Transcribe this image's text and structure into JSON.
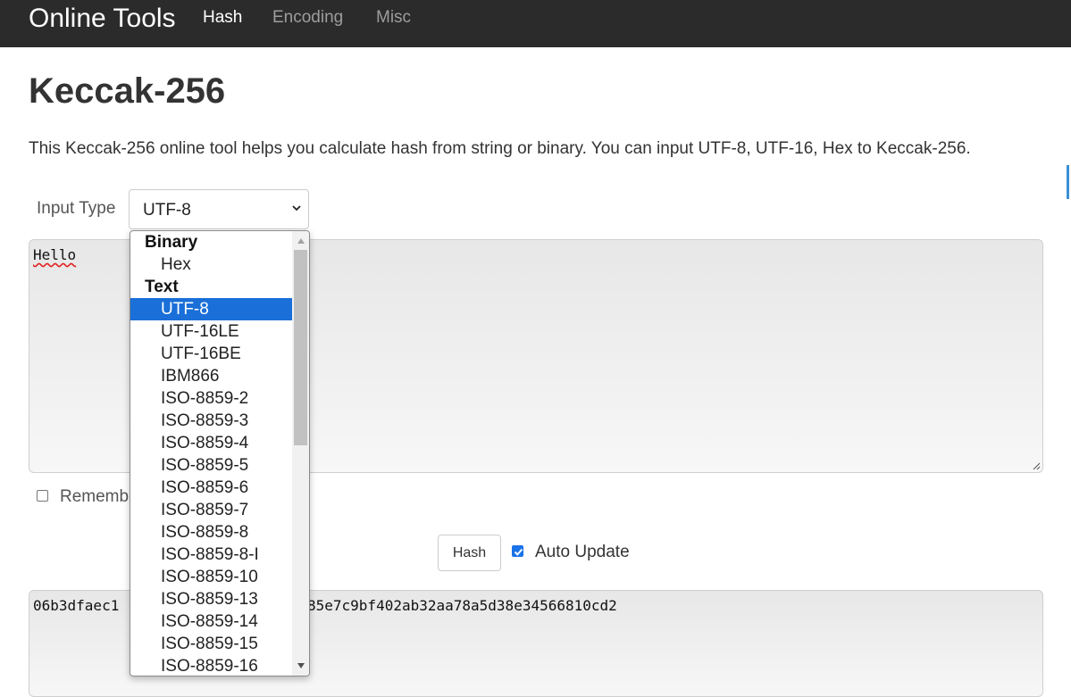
{
  "navbar": {
    "brand": "Online Tools",
    "links": [
      {
        "label": "Hash",
        "active": true
      },
      {
        "label": "Encoding",
        "active": false
      },
      {
        "label": "Misc",
        "active": false
      }
    ]
  },
  "page": {
    "title": "Keccak-256",
    "description": "This Keccak-256 online tool helps you calculate hash from string or binary. You can input UTF-8, UTF-16, Hex to Keccak-256."
  },
  "input_type": {
    "label": "Input Type",
    "selected": "UTF-8",
    "icon": "chevron-down-icon"
  },
  "input": {
    "value": "Hello"
  },
  "remember": {
    "label": "Rememb",
    "checked": false
  },
  "actions": {
    "hash_label": "Hash",
    "auto_update_label": "Auto Update",
    "auto_update_checked": true
  },
  "output": {
    "value_left": "06b3dfaec1",
    "value_right": "85e7c9bf402ab32aa78a5d38e34566810cd2"
  },
  "dropdown": {
    "options": [
      {
        "label": "Binary",
        "group": true
      },
      {
        "label": "Hex",
        "group": false
      },
      {
        "label": "Text",
        "group": true
      },
      {
        "label": "UTF-8",
        "group": false,
        "selected": true
      },
      {
        "label": "UTF-16LE",
        "group": false
      },
      {
        "label": "UTF-16BE",
        "group": false
      },
      {
        "label": "IBM866",
        "group": false
      },
      {
        "label": "ISO-8859-2",
        "group": false
      },
      {
        "label": "ISO-8859-3",
        "group": false
      },
      {
        "label": "ISO-8859-4",
        "group": false
      },
      {
        "label": "ISO-8859-5",
        "group": false
      },
      {
        "label": "ISO-8859-6",
        "group": false
      },
      {
        "label": "ISO-8859-7",
        "group": false
      },
      {
        "label": "ISO-8859-8",
        "group": false
      },
      {
        "label": "ISO-8859-8-I",
        "group": false
      },
      {
        "label": "ISO-8859-10",
        "group": false
      },
      {
        "label": "ISO-8859-13",
        "group": false
      },
      {
        "label": "ISO-8859-14",
        "group": false
      },
      {
        "label": "ISO-8859-15",
        "group": false
      },
      {
        "label": "ISO-8859-16",
        "group": false
      }
    ]
  },
  "colors": {
    "navbar_bg": "#2b2b2b",
    "selected_option_bg": "#1a6fd8",
    "checkbox_checked": "#1a73e8"
  }
}
